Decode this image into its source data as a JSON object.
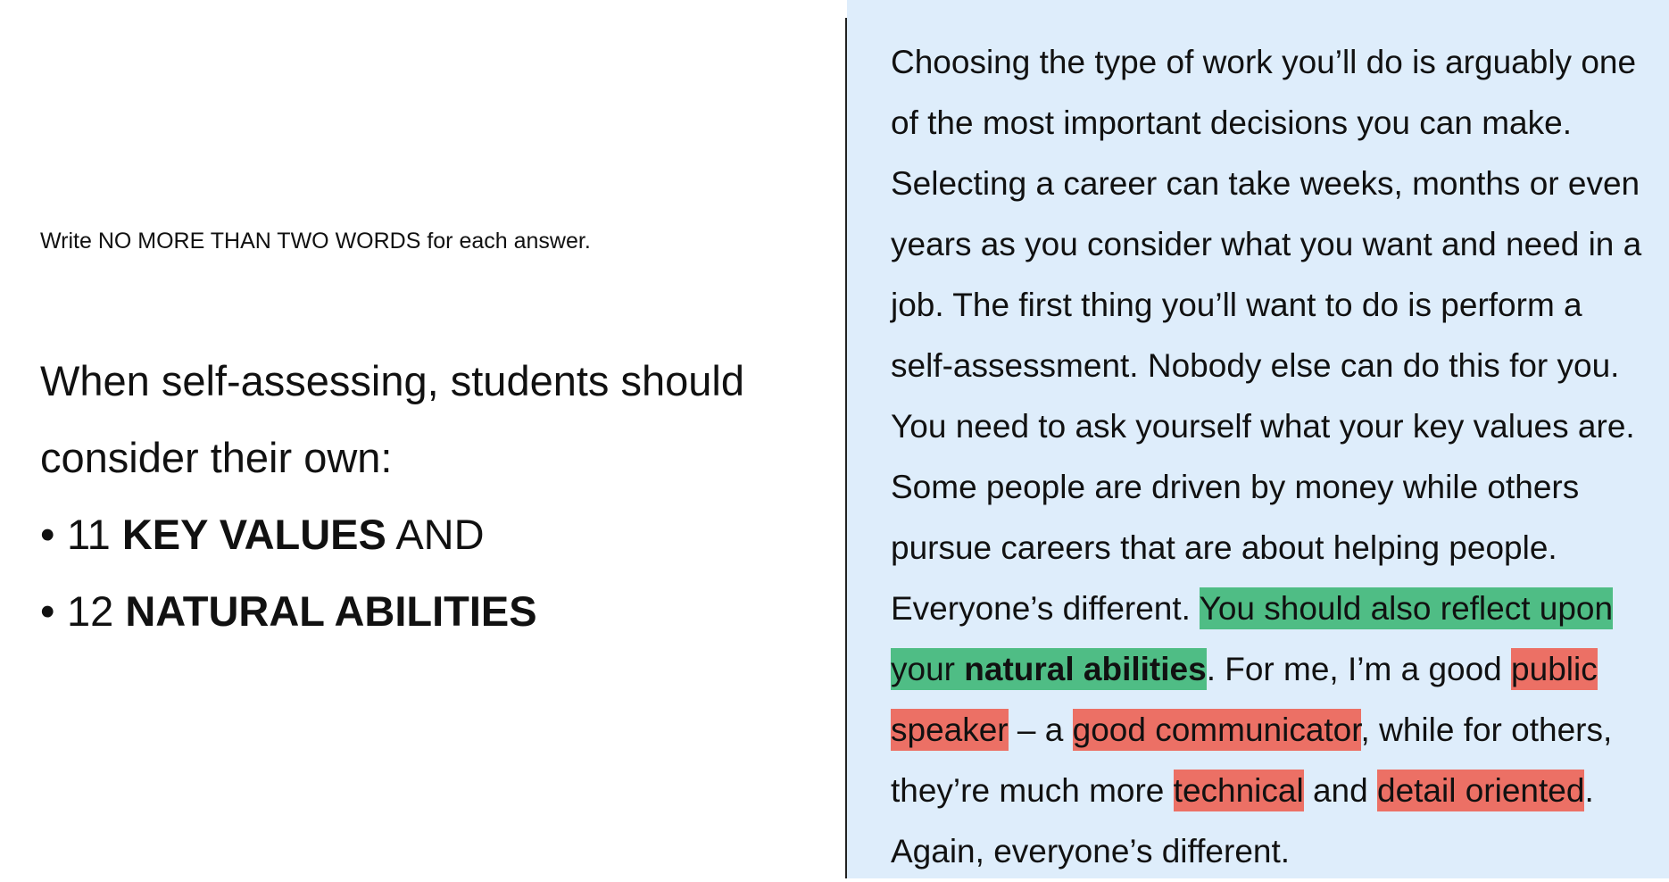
{
  "left": {
    "instruction": "Write NO MORE THAN TWO WORDS for each answer.",
    "question": {
      "line1": "When self-assessing, students should",
      "line2": "consider their own:",
      "bullet": "•",
      "item1": {
        "number": "11",
        "answer": "KEY VALUES",
        "suffix": "AND"
      },
      "item2": {
        "number": "12",
        "answer": "NATURAL ABILITIES"
      }
    }
  },
  "passage": {
    "l1": "Choosing the type of work you’ll do is arguably one",
    "l2": "of the most important decisions you can make.",
    "l3": "Selecting a career can take weeks, months or even",
    "l4": "years as you consider what you want and need in a",
    "l5": "job. The first thing you’ll want to do is perform a",
    "l6": "self-assessment. Nobody else can do this for you.",
    "l7": "You need to ask yourself what your key values are.",
    "l8": "Some people are driven by money while others",
    "l9": "pursue careers that are about helping people.",
    "l10": {
      "a": "Everyone’s different. ",
      "hl": "You should also reflect upon"
    },
    "l11": {
      "hl_a": "your ",
      "hl_bold": "natural abilities",
      "b": ". For me, I’m a good ",
      "hl_red": "public"
    },
    "l12": {
      "hl_red1": "speaker",
      "a": " – a ",
      "hl_red2": "good communicator",
      "b": ", while for others,"
    },
    "l13": {
      "a": "they’re much more ",
      "hl_red1": "technical",
      "b": " and ",
      "hl_red2": "detail oriented",
      "c": "."
    },
    "l14": "Again, everyone’s different."
  },
  "colors": {
    "passage_background": "#deedfb",
    "highlight_green": "#4fbd85",
    "highlight_red": "#ec7065"
  }
}
